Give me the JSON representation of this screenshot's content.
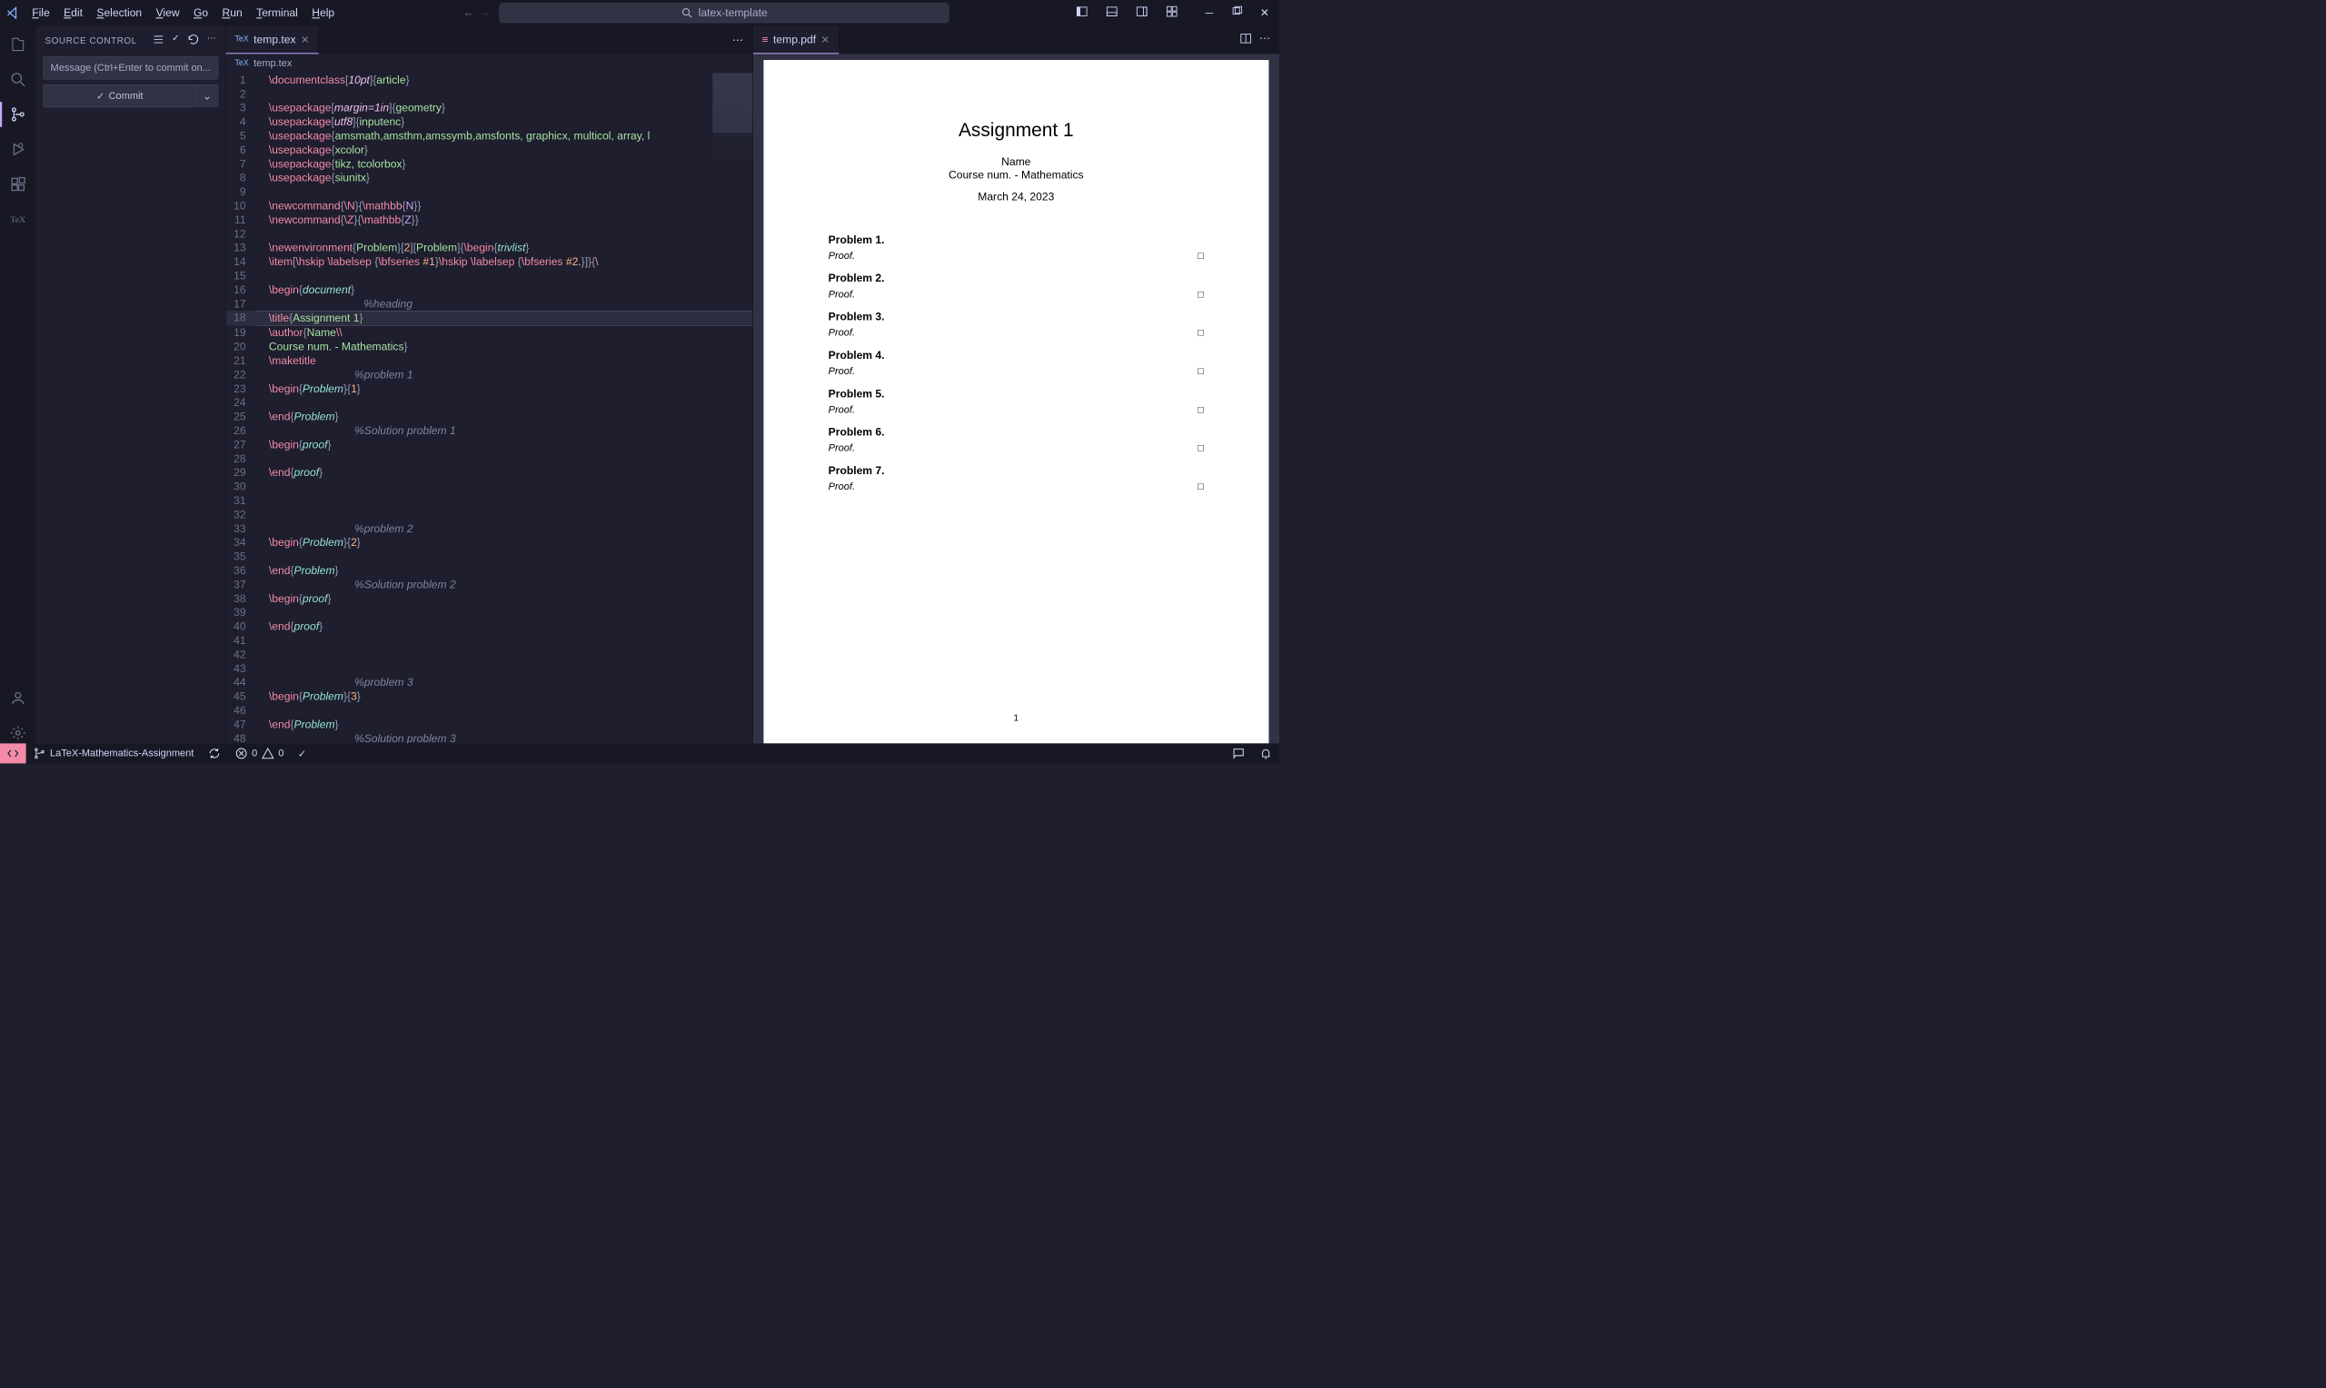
{
  "titlebar": {
    "menu": [
      "File",
      "Edit",
      "Selection",
      "View",
      "Go",
      "Run",
      "Terminal",
      "Help"
    ],
    "search_placeholder": "latex-template"
  },
  "sidebar": {
    "title": "SOURCE CONTROL",
    "commit_placeholder": "Message (Ctrl+Enter to commit on...",
    "commit_button": "Commit"
  },
  "tabs": {
    "editor": {
      "label": "temp.tex",
      "ext": "TeX"
    },
    "pdf": {
      "label": "temp.pdf"
    }
  },
  "breadcrumb": {
    "ext": "TeX",
    "file": "temp.tex"
  },
  "editor": {
    "current_line": 18,
    "lines": [
      {
        "n": 1,
        "seg": [
          [
            "kw",
            "\\documentclass"
          ],
          [
            "pn",
            "["
          ],
          [
            "opt",
            "10pt"
          ],
          [
            "pn",
            "]{"
          ],
          [
            "str",
            "article"
          ],
          [
            "pn",
            "}"
          ]
        ]
      },
      {
        "n": 2,
        "seg": []
      },
      {
        "n": 3,
        "seg": [
          [
            "kw",
            "\\usepackage"
          ],
          [
            "pn",
            "["
          ],
          [
            "opt",
            "margin=1in"
          ],
          [
            "pn",
            "]{"
          ],
          [
            "str",
            "geometry"
          ],
          [
            "pn",
            "}"
          ]
        ]
      },
      {
        "n": 4,
        "seg": [
          [
            "kw",
            "\\usepackage"
          ],
          [
            "pn",
            "["
          ],
          [
            "opt",
            "utf8"
          ],
          [
            "pn",
            "]{"
          ],
          [
            "str",
            "inputenc"
          ],
          [
            "pn",
            "}"
          ]
        ]
      },
      {
        "n": 5,
        "seg": [
          [
            "kw",
            "\\usepackage"
          ],
          [
            "pn",
            "{"
          ],
          [
            "str",
            "amsmath,amsthm,amssymb,amsfonts, graphicx, multicol, array, l"
          ]
        ]
      },
      {
        "n": 6,
        "seg": [
          [
            "kw",
            "\\usepackage"
          ],
          [
            "pn",
            "{"
          ],
          [
            "str",
            "xcolor"
          ],
          [
            "pn",
            "}"
          ]
        ]
      },
      {
        "n": 7,
        "seg": [
          [
            "kw",
            "\\usepackage"
          ],
          [
            "pn",
            "{"
          ],
          [
            "str",
            "tikz, tcolorbox"
          ],
          [
            "pn",
            "}"
          ]
        ]
      },
      {
        "n": 8,
        "seg": [
          [
            "kw",
            "\\usepackage"
          ],
          [
            "pn",
            "{"
          ],
          [
            "str",
            "siunitx"
          ],
          [
            "pn",
            "}"
          ]
        ]
      },
      {
        "n": 9,
        "seg": []
      },
      {
        "n": 10,
        "seg": [
          [
            "kw",
            "\\newcommand"
          ],
          [
            "pn",
            "{"
          ],
          [
            "kw",
            "\\N"
          ],
          [
            "pn",
            "}{"
          ],
          [
            "kw",
            "\\mathbb"
          ],
          [
            "pn",
            "{"
          ],
          [
            "arg",
            "N"
          ],
          [
            "pn",
            "}}"
          ]
        ]
      },
      {
        "n": 11,
        "seg": [
          [
            "kw",
            "\\newcommand"
          ],
          [
            "pn",
            "{"
          ],
          [
            "kw",
            "\\Z"
          ],
          [
            "pn",
            "}{"
          ],
          [
            "kw",
            "\\mathbb"
          ],
          [
            "pn",
            "{"
          ],
          [
            "arg",
            "Z"
          ],
          [
            "pn",
            "}}"
          ]
        ]
      },
      {
        "n": 12,
        "seg": []
      },
      {
        "n": 13,
        "seg": [
          [
            "kw",
            "\\newenvironment"
          ],
          [
            "pn",
            "{"
          ],
          [
            "str",
            "Problem"
          ],
          [
            "pn",
            "}["
          ],
          [
            "num",
            "2"
          ],
          [
            "pn",
            "]["
          ],
          [
            "str",
            "Problem"
          ],
          [
            "pn",
            "]{"
          ],
          [
            "kw",
            "\\begin"
          ],
          [
            "pn",
            "{"
          ],
          [
            "env",
            "trivlist"
          ],
          [
            "pn",
            "}"
          ]
        ]
      },
      {
        "n": 14,
        "seg": [
          [
            "kw",
            "\\item"
          ],
          [
            "pn",
            "["
          ],
          [
            "kw",
            "\\hskip \\labelsep "
          ],
          [
            "pn",
            "{"
          ],
          [
            "kw",
            "\\bfseries "
          ],
          [
            "num",
            "#1"
          ],
          [
            "pn",
            "}"
          ],
          [
            "kw",
            "\\hskip \\labelsep "
          ],
          [
            "pn",
            "{"
          ],
          [
            "kw",
            "\\bfseries "
          ],
          [
            "num",
            "#2"
          ],
          [
            "pl",
            "."
          ],
          [
            "pn",
            "}]}{"
          ],
          [
            "kw",
            "\\"
          ]
        ]
      },
      {
        "n": 15,
        "seg": []
      },
      {
        "n": 16,
        "seg": [
          [
            "kw",
            "\\begin"
          ],
          [
            "pn",
            "{"
          ],
          [
            "env",
            "document"
          ],
          [
            "pn",
            "}"
          ]
        ]
      },
      {
        "n": 17,
        "seg": [
          [
            "pl",
            "                               "
          ],
          [
            "cm",
            "%heading"
          ]
        ]
      },
      {
        "n": 18,
        "seg": [
          [
            "kw",
            "\\title"
          ],
          [
            "pn",
            "{"
          ],
          [
            "str",
            "Assignment 1"
          ],
          [
            "pn",
            "}"
          ]
        ]
      },
      {
        "n": 19,
        "seg": [
          [
            "kw",
            "\\author"
          ],
          [
            "pn",
            "{"
          ],
          [
            "str",
            "Name"
          ],
          [
            "kw",
            "\\\\"
          ]
        ]
      },
      {
        "n": 20,
        "seg": [
          [
            "str",
            "Course num. - Mathematics"
          ],
          [
            "pn",
            "}"
          ]
        ]
      },
      {
        "n": 21,
        "seg": [
          [
            "kw",
            "\\maketitle"
          ]
        ]
      },
      {
        "n": 22,
        "seg": [
          [
            "pl",
            "                            "
          ],
          [
            "cm",
            "%problem 1"
          ]
        ]
      },
      {
        "n": 23,
        "seg": [
          [
            "kw",
            "\\begin"
          ],
          [
            "pn",
            "{"
          ],
          [
            "env",
            "Problem"
          ],
          [
            "pn",
            "}{"
          ],
          [
            "num",
            "1"
          ],
          [
            "pn",
            "}"
          ]
        ]
      },
      {
        "n": 24,
        "seg": []
      },
      {
        "n": 25,
        "seg": [
          [
            "kw",
            "\\end"
          ],
          [
            "pn",
            "{"
          ],
          [
            "env",
            "Problem"
          ],
          [
            "pn",
            "}"
          ]
        ]
      },
      {
        "n": 26,
        "seg": [
          [
            "pl",
            "                            "
          ],
          [
            "cm",
            "%Solution problem 1"
          ]
        ]
      },
      {
        "n": 27,
        "seg": [
          [
            "kw",
            "\\begin"
          ],
          [
            "pn",
            "{"
          ],
          [
            "env",
            "proof"
          ],
          [
            "pn",
            "}"
          ]
        ]
      },
      {
        "n": 28,
        "seg": []
      },
      {
        "n": 29,
        "seg": [
          [
            "kw",
            "\\end"
          ],
          [
            "pn",
            "{"
          ],
          [
            "env",
            "proof"
          ],
          [
            "pn",
            "}"
          ]
        ]
      },
      {
        "n": 30,
        "seg": []
      },
      {
        "n": 31,
        "seg": []
      },
      {
        "n": 32,
        "seg": []
      },
      {
        "n": 33,
        "seg": [
          [
            "pl",
            "                            "
          ],
          [
            "cm",
            "%problem 2"
          ]
        ]
      },
      {
        "n": 34,
        "seg": [
          [
            "kw",
            "\\begin"
          ],
          [
            "pn",
            "{"
          ],
          [
            "env",
            "Problem"
          ],
          [
            "pn",
            "}{"
          ],
          [
            "num",
            "2"
          ],
          [
            "pn",
            "}"
          ]
        ]
      },
      {
        "n": 35,
        "seg": []
      },
      {
        "n": 36,
        "seg": [
          [
            "kw",
            "\\end"
          ],
          [
            "pn",
            "{"
          ],
          [
            "env",
            "Problem"
          ],
          [
            "pn",
            "}"
          ]
        ]
      },
      {
        "n": 37,
        "seg": [
          [
            "pl",
            "                            "
          ],
          [
            "cm",
            "%Solution problem 2"
          ]
        ]
      },
      {
        "n": 38,
        "seg": [
          [
            "kw",
            "\\begin"
          ],
          [
            "pn",
            "{"
          ],
          [
            "env",
            "proof"
          ],
          [
            "pn",
            "}"
          ]
        ]
      },
      {
        "n": 39,
        "seg": []
      },
      {
        "n": 40,
        "seg": [
          [
            "kw",
            "\\end"
          ],
          [
            "pn",
            "{"
          ],
          [
            "env",
            "proof"
          ],
          [
            "pn",
            "}"
          ]
        ]
      },
      {
        "n": 41,
        "seg": []
      },
      {
        "n": 42,
        "seg": []
      },
      {
        "n": 43,
        "seg": []
      },
      {
        "n": 44,
        "seg": [
          [
            "pl",
            "                            "
          ],
          [
            "cm",
            "%problem 3"
          ]
        ]
      },
      {
        "n": 45,
        "seg": [
          [
            "kw",
            "\\begin"
          ],
          [
            "pn",
            "{"
          ],
          [
            "env",
            "Problem"
          ],
          [
            "pn",
            "}{"
          ],
          [
            "num",
            "3"
          ],
          [
            "pn",
            "}"
          ]
        ]
      },
      {
        "n": 46,
        "seg": []
      },
      {
        "n": 47,
        "seg": [
          [
            "kw",
            "\\end"
          ],
          [
            "pn",
            "{"
          ],
          [
            "env",
            "Problem"
          ],
          [
            "pn",
            "}"
          ]
        ]
      },
      {
        "n": 48,
        "seg": [
          [
            "pl",
            "                            "
          ],
          [
            "cm",
            "%Solution problem 3"
          ]
        ]
      }
    ]
  },
  "pdf": {
    "title": "Assignment 1",
    "author": "Name",
    "course": "Course num. - Mathematics",
    "date": "March 24, 2023",
    "problems": [
      {
        "label": "Problem 1.",
        "proof": "Proof."
      },
      {
        "label": "Problem 2.",
        "proof": "Proof."
      },
      {
        "label": "Problem 3.",
        "proof": "Proof."
      },
      {
        "label": "Problem 4.",
        "proof": "Proof."
      },
      {
        "label": "Problem 5.",
        "proof": "Proof."
      },
      {
        "label": "Problem 6.",
        "proof": "Proof."
      },
      {
        "label": "Problem 7.",
        "proof": "Proof."
      }
    ],
    "page": "1",
    "qed": "□"
  },
  "statusbar": {
    "branch": "LaTeX-Mathematics-Assignment",
    "errors": "0",
    "warnings": "0"
  }
}
